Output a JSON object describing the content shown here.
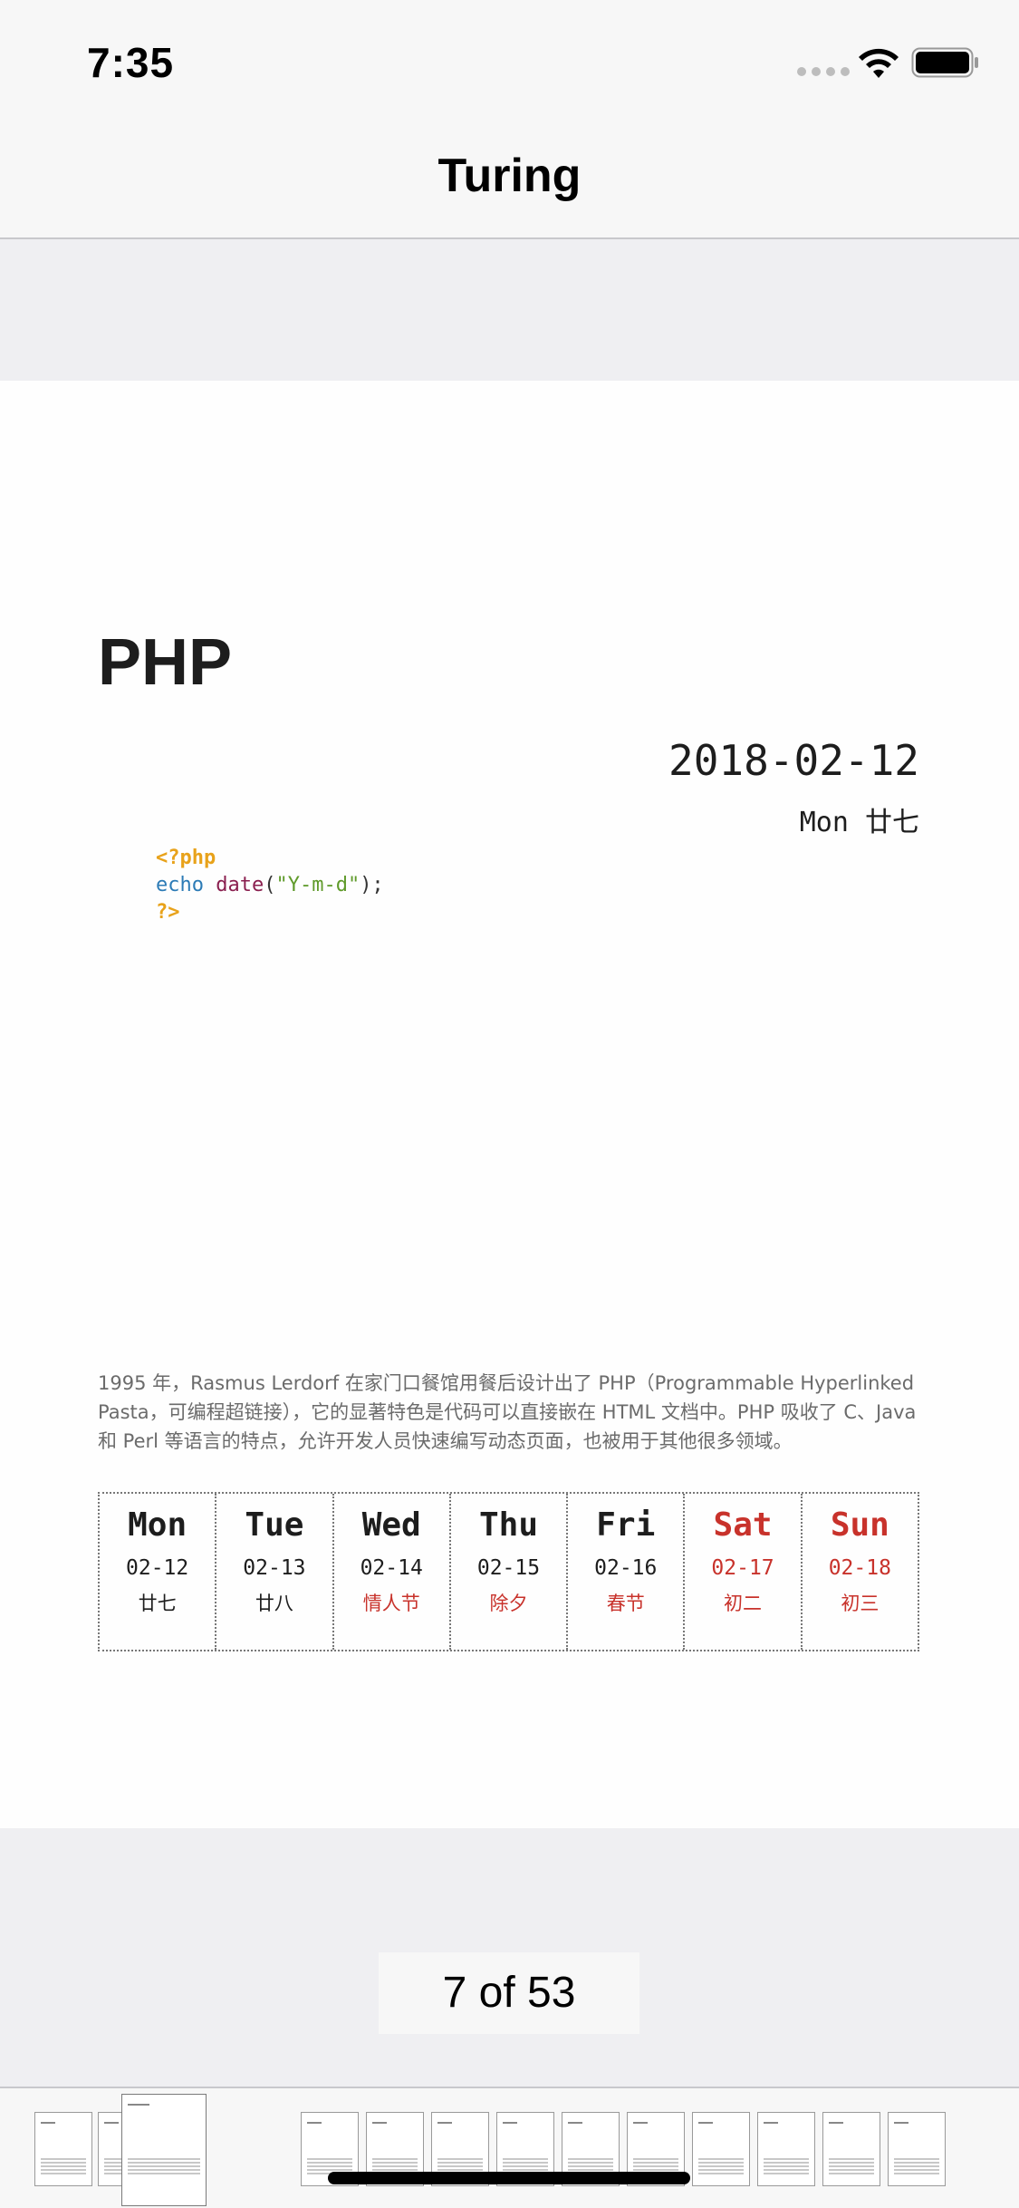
{
  "status_bar": {
    "time": "7:35"
  },
  "nav": {
    "title": "Turing"
  },
  "document": {
    "title": "PHP",
    "date": "2018-02-12",
    "weekday_lunar": "Mon 廿七",
    "code": {
      "open_tag": "<?php",
      "echo_keyword": "echo",
      "function_name": "date",
      "open_paren": "(",
      "string_arg": "\"Y-m-d\"",
      "close": ");",
      "close_tag": "?>"
    },
    "description": "1995 年，Rasmus Lerdorf 在家门口餐馆用餐后设计出了 PHP（Programmable Hyperlinked Pasta，可编程超链接），它的显著特色是代码可以直接嵌在 HTML 文档中。PHP 吸收了 C、Java 和 Perl 等语言的特点，允许开发人员快速编写动态页面，也被用于其他很多领域。",
    "week": [
      {
        "name": "Mon",
        "date": "02-12",
        "lunar": "廿七",
        "name_red": false,
        "lunar_red": false
      },
      {
        "name": "Tue",
        "date": "02-13",
        "lunar": "廿八",
        "name_red": false,
        "lunar_red": false
      },
      {
        "name": "Wed",
        "date": "02-14",
        "lunar": "情人节",
        "name_red": false,
        "lunar_red": true
      },
      {
        "name": "Thu",
        "date": "02-15",
        "lunar": "除夕",
        "name_red": false,
        "lunar_red": true
      },
      {
        "name": "Fri",
        "date": "02-16",
        "lunar": "春节",
        "name_red": false,
        "lunar_red": true
      },
      {
        "name": "Sat",
        "date": "02-17",
        "lunar": "初二",
        "name_red": true,
        "lunar_red": true
      },
      {
        "name": "Sun",
        "date": "02-18",
        "lunar": "初三",
        "name_red": true,
        "lunar_red": true
      }
    ]
  },
  "pager": {
    "label": "7 of 53",
    "current_page": 7,
    "total_pages": 53
  },
  "colors": {
    "accent_red": "#c8322b",
    "php_tag": "#e8a21a",
    "keyword_blue": "#2c7bb6"
  }
}
